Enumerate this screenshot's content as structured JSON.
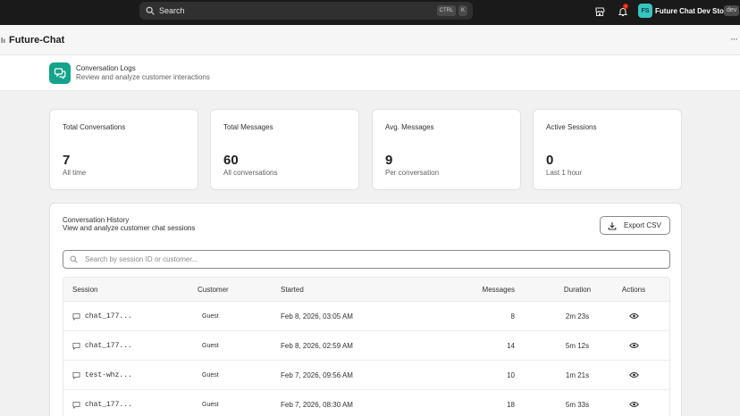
{
  "topbar": {
    "search_label": "Search",
    "shortcut_ctrl": "CTRL",
    "shortcut_key": "K",
    "notification_count": "1",
    "store_initials": "FS",
    "store_name": "Future Chat Dev Store",
    "store_badge": "dev"
  },
  "app": {
    "title": "Future-Chat",
    "more_label": "···"
  },
  "page": {
    "title": "Conversation Logs",
    "subtitle": "Review and analyze customer interactions"
  },
  "stats": [
    {
      "label": "Total Conversations",
      "value": "7",
      "sub": "All time"
    },
    {
      "label": "Total Messages",
      "value": "60",
      "sub": "All conversations"
    },
    {
      "label": "Avg. Messages",
      "value": "9",
      "sub": "Per conversation"
    },
    {
      "label": "Active Sessions",
      "value": "0",
      "sub": "Last 1 hour"
    }
  ],
  "history": {
    "title": "Conversation History",
    "subtitle": "View and analyze customer chat sessions",
    "export_label": "Export CSV",
    "search_placeholder": "Search by session ID or customer...",
    "columns": {
      "session": "Session",
      "customer": "Customer",
      "started": "Started",
      "messages": "Messages",
      "duration": "Duration",
      "actions": "Actions"
    },
    "rows": [
      {
        "session": "chat_177...",
        "customer": "Guest",
        "started": "Feb 8, 2026, 03:05 AM",
        "messages": "8",
        "duration": "2m 23s"
      },
      {
        "session": "chat_177...",
        "customer": "Guest",
        "started": "Feb 8, 2026, 02:59 AM",
        "messages": "14",
        "duration": "5m 12s"
      },
      {
        "session": "test-whz...",
        "customer": "Guest",
        "started": "Feb 7, 2026, 09:56 AM",
        "messages": "10",
        "duration": "1m 21s"
      },
      {
        "session": "chat_177...",
        "customer": "Guest",
        "started": "Feb 7, 2026, 08:30 AM",
        "messages": "18",
        "duration": "5m 33s"
      }
    ]
  },
  "colors": {
    "topbar_bg": "#1a1a1a",
    "page_icon_bg": "#14a38b",
    "store_avatar_bg": "#36c5c0",
    "badge_red": "#e51c00"
  }
}
